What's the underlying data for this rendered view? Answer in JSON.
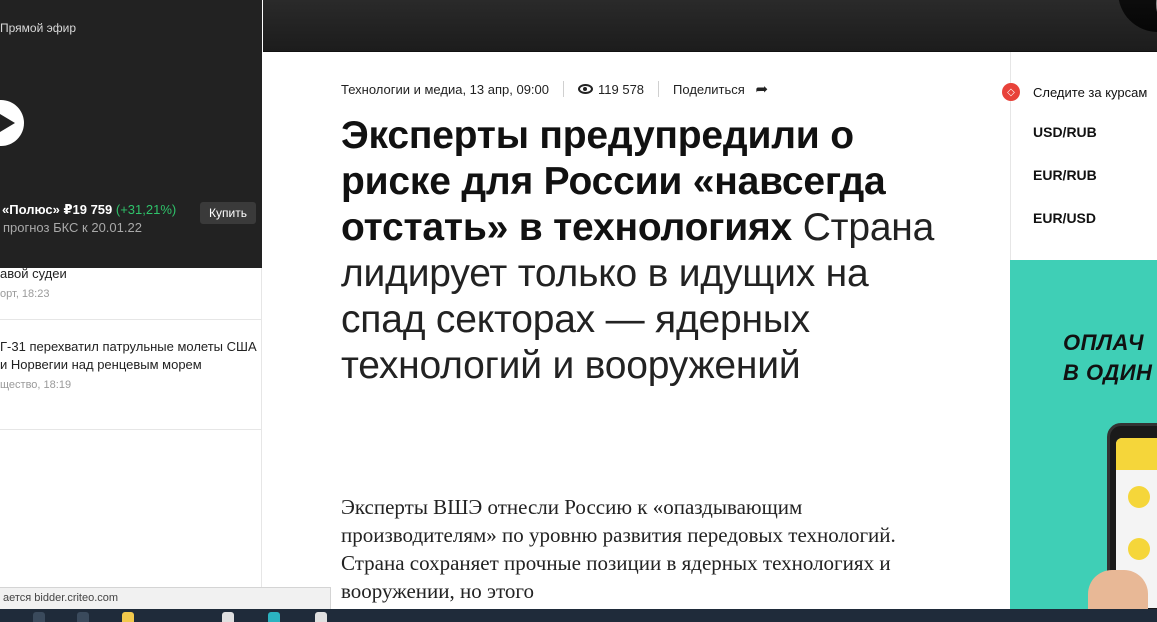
{
  "left_sidebar": {
    "live_label": "Прямой эфир",
    "stock": {
      "name": "«Полюс» ₽19 759",
      "change": "(+31,21%)",
      "forecast": "прогноз БКС к 20.01.22",
      "buy_label": "Купить"
    },
    "news": [
      {
        "title": "авой судеи",
        "meta": "орт, 18:23"
      },
      {
        "title": "Г-31 перехватил патрульные молеты США и Норвегии над ренцевым морем",
        "meta": "щество, 18:19"
      }
    ],
    "status_url": "ается bidder.criteo.com"
  },
  "article": {
    "meta": {
      "category_date": "Технологии и медиа, 13 апр, 09:00",
      "views": "119 578",
      "share_label": "Поделиться"
    },
    "headline_bold": "Эксперты предупредили о риске для России «навсегда отстать» в технологиях",
    "headline_rest": " Страна лидирует только в идущих на спад секторах — ядерных технологий и вооружений",
    "lead": "Эксперты ВШЭ отнесли Россию к «опаздывающим производителям» по уровню развития передовых технологий. Страна сохраняет прочные позиции в ядерных технологиях и вооружении, но этого"
  },
  "rates": {
    "header": "Следите за курсам",
    "pairs": [
      "USD/RUB",
      "EUR/RUB",
      "EUR/USD"
    ]
  },
  "ad": {
    "line1": "ОПЛАЧ",
    "line2": "В ОДИН"
  },
  "colors": {
    "accent_red": "#e8423a",
    "positive_green": "#2fc26a",
    "ad_background": "#3fcfb6"
  }
}
